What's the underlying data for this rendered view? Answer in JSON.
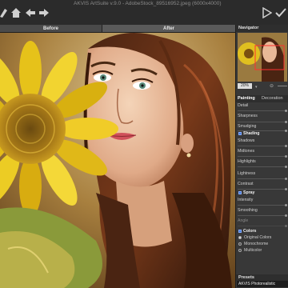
{
  "window": {
    "title": "AKVIS ArtSuite v.9.0 - AdobeStock_89516952.jpeg (6000x4000)"
  },
  "toolbar": {
    "icons": [
      "brush-icon",
      "home-icon",
      "undo-icon",
      "redo-icon",
      "play-icon",
      "apply-icon"
    ]
  },
  "view_tabs": {
    "before": "Before",
    "after": "After"
  },
  "navigator": {
    "title": "Navigator",
    "zoom": "20%"
  },
  "settings": {
    "tabs": {
      "painting": "Painting",
      "decoration": "Decoration"
    },
    "detail": "Detail",
    "sharpness": "Sharpness",
    "smudging": "Smudging",
    "shading_title": "Shading",
    "shadows": "Shadows",
    "midtones": "Midtones",
    "highlights": "Highlights",
    "lightness": "Lightness",
    "contrast": "Contrast",
    "spray_title": "Spray",
    "intensity": "Intensity",
    "smoothing": "Smoothing",
    "angle": "Angle",
    "colors_title": "Colors",
    "color_options": [
      "Original Colors",
      "Monochrome",
      "Multicolor"
    ],
    "presets_title": "Presets",
    "preset_value": "AKVIS Photorealistic"
  },
  "colors": {
    "accent": "#3c7ad6",
    "panel": "#383838",
    "titlebar": "#2b2b2b"
  }
}
